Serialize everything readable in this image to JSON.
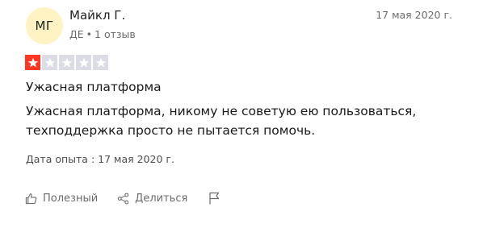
{
  "review": {
    "avatar_initials": "МГ",
    "author_name": "Майкл Г.",
    "country": "ДЕ",
    "review_count": "1 отзыв",
    "date": "17 мая 2020 г.",
    "rating": 1,
    "rating_max": 5,
    "title": "Ужасная платформа",
    "body": "Ужасная платформа, никому не советую ею пользоваться, техподдержка просто не пытается помочь.",
    "experience_label": "Дата опыта :",
    "experience_date": "17 мая 2020 г."
  },
  "actions": {
    "useful_label": "Полезный",
    "share_label": "Делиться"
  },
  "colors": {
    "star_filled": "#ff3722",
    "star_empty": "#dcdce6",
    "avatar_bg": "#fff3c4"
  },
  "icons": {
    "useful": "thumbs-up-icon",
    "share": "share-icon",
    "report": "flag-icon",
    "star": "star-icon"
  }
}
